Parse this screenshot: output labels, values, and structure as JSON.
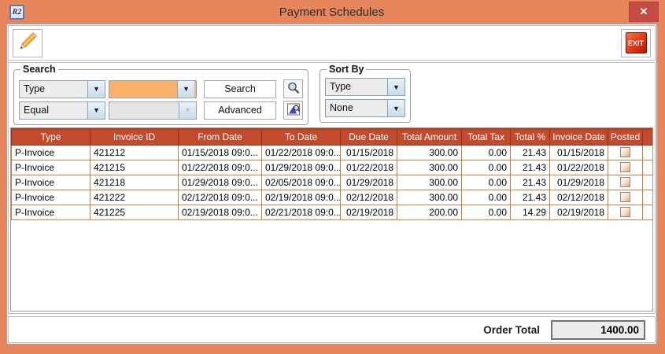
{
  "window": {
    "title": "Payment Schedules",
    "icon_text": "R2",
    "close_glyph": "x"
  },
  "toolbar": {
    "edit_icon": "pencil-icon",
    "exit_label": "EXIT"
  },
  "search": {
    "legend": "Search",
    "field_selector": "Type",
    "operator_selector": "Equal",
    "value_primary": "",
    "value_secondary": "",
    "search_button": "Search",
    "advanced_button": "Advanced",
    "search_icon": "magnifier-icon",
    "advanced_icon": "advanced-find-icon"
  },
  "sort": {
    "legend": "Sort By",
    "primary": "Type",
    "secondary": "None"
  },
  "table": {
    "columns": [
      "Type",
      "Invoice ID",
      "From Date",
      "To Date",
      "Due Date",
      "Total Amount",
      "Total Tax",
      "Total %",
      "Invoice Date",
      "Posted"
    ],
    "rows": [
      {
        "cells": [
          "P-Invoice",
          "421212",
          "01/15/2018 09:0...",
          "01/22/2018 09:0...",
          "01/15/2018",
          "300.00",
          "0.00",
          "21.43",
          "01/15/2018"
        ],
        "posted": false
      },
      {
        "cells": [
          "P-Invoice",
          "421215",
          "01/22/2018 09:0...",
          "01/29/2018 09:0...",
          "01/22/2018",
          "300.00",
          "0.00",
          "21.43",
          "01/22/2018"
        ],
        "posted": false
      },
      {
        "cells": [
          "P-Invoice",
          "421218",
          "01/29/2018 09:0...",
          "02/05/2018 09:0...",
          "01/29/2018",
          "300.00",
          "0.00",
          "21.43",
          "01/29/2018"
        ],
        "posted": false
      },
      {
        "cells": [
          "P-Invoice",
          "421222",
          "02/12/2018 09:0...",
          "02/19/2018 09:0...",
          "02/12/2018",
          "300.00",
          "0.00",
          "21.43",
          "02/12/2018"
        ],
        "posted": false
      },
      {
        "cells": [
          "P-Invoice",
          "421225",
          "02/19/2018 09:0...",
          "02/21/2018 09:0...",
          "02/19/2018",
          "200.00",
          "0.00",
          "14.29",
          "02/19/2018"
        ],
        "posted": false
      }
    ]
  },
  "footer": {
    "order_total_label": "Order Total",
    "order_total_value": "1400.00"
  },
  "colors": {
    "window_chrome": "#e8865b",
    "close_button": "#c54b45",
    "grid_header": "#c24b2d",
    "grid_lines": "#c97c3e",
    "active_field": "#fbb169",
    "exit_button": "#c01d08"
  }
}
